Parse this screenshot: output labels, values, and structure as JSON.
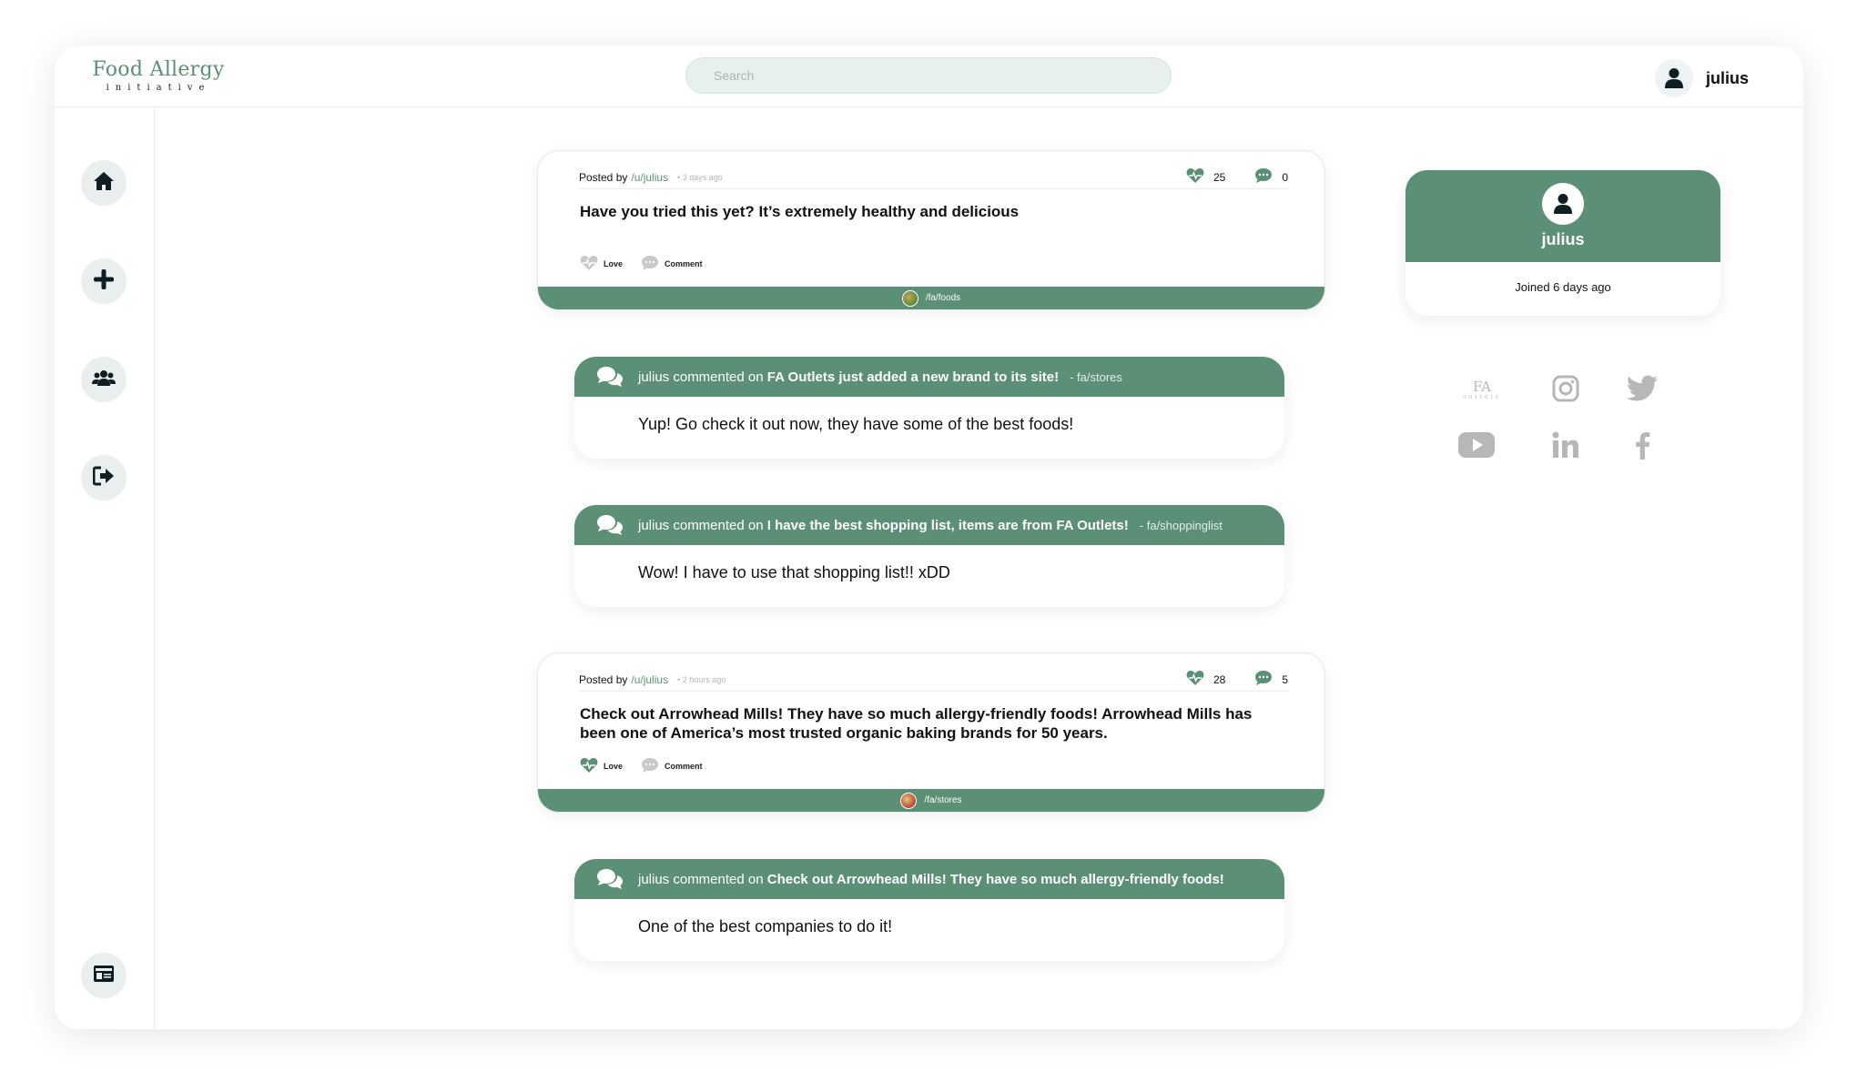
{
  "brand": {
    "logo_main": "Food Allergy",
    "logo_sub": "initiative"
  },
  "search": {
    "placeholder": "Search"
  },
  "header": {
    "username": "julius"
  },
  "sidebar": {
    "items": [
      "home-icon",
      "plus-icon",
      "users-icon",
      "logout-icon",
      "id-card-icon"
    ]
  },
  "posts": [
    {
      "posted_by": "Posted by",
      "user": "/u/julius",
      "time": "• 3 days ago",
      "loves": "25",
      "comments": "0",
      "title": "Have you tried this yet? It’s extremely healthy and delicious",
      "love_label": "Love",
      "comment_label": "Comment",
      "community": "/fa/foods"
    },
    {
      "posted_by": "Posted by",
      "user": "/u/julius",
      "time": "• 2 hours ago",
      "loves": "28",
      "comments": "5",
      "title": "Check out Arrowhead Mills! They have so much allergy-friendly foods! Arrowhead Mills has been one of America’s most trusted organic baking brands for 50 years.",
      "love_label": "Love",
      "comment_label": "Comment",
      "community": "/fa/stores"
    }
  ],
  "comments": [
    {
      "prefix": "julius commented on ",
      "post_title": "FA Outlets just added a new brand to its site!",
      "community": "- fa/stores",
      "text": "Yup! Go check it out now, they have some of the best foods!"
    },
    {
      "prefix": "julius commented on ",
      "post_title": "I have the best shopping list, items are from FA Outlets!",
      "community": "- fa/shoppinglist",
      "text": "Wow! I have to use that shopping list!! xDD"
    },
    {
      "prefix": "julius commented on ",
      "post_title": "Check out Arrowhead Mills! They have so much allergy-friendly foods!",
      "community": "",
      "text": "One of the best companies to do it!"
    }
  ],
  "profile": {
    "name": "julius",
    "joined": "Joined 6 days ago"
  },
  "socials": {
    "fa_outlets_main": "FA",
    "fa_outlets_sub": "outlets",
    "icons": [
      "fa-outlets-logo",
      "instagram-icon",
      "twitter-icon",
      "youtube-icon",
      "linkedin-icon",
      "facebook-icon"
    ]
  },
  "colors": {
    "accent": "#5b8f76",
    "icon_bg": "#e9efee",
    "social_grey": "#b7b7b7"
  }
}
